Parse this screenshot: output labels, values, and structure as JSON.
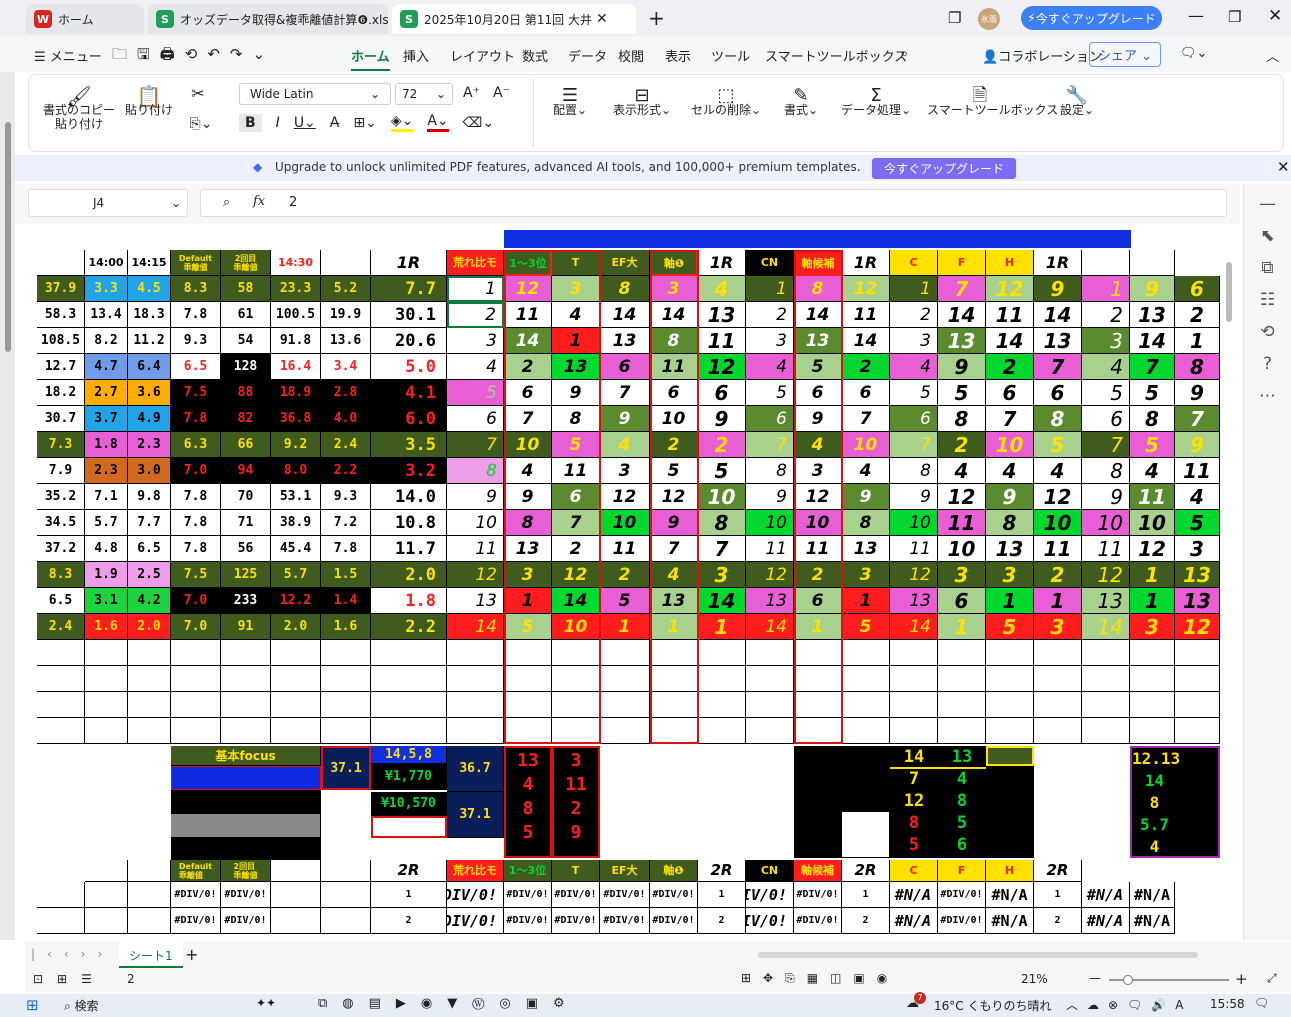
{
  "tabs": [
    {
      "icon": "W",
      "label": "ホーム",
      "color": "#d7261e"
    },
    {
      "icon": "S",
      "label": "オッズデータ取得&複乖離値計算❻.xlsx",
      "color": "#1e9e57"
    },
    {
      "icon": "S",
      "label": "2025年10月20日 第11回 大井",
      "color": "#1e9e57"
    }
  ],
  "upgrade_btn": "今すぐアップグレード",
  "avatar": "氷雨",
  "menu": {
    "main": "メニュー",
    "items": [
      "ホーム",
      "挿入",
      "レイアウト",
      "数式",
      "データ",
      "校閲",
      "表示",
      "ツール",
      "スマートツールボックス"
    ],
    "collab": "コラボレーション",
    "share": "シェア"
  },
  "ribbon": {
    "copy_fmt": "書式のコピー\n貼り付け",
    "paste": "貼り付け",
    "font": "Wide Latin",
    "size": "72",
    "align": "配置",
    "numfmt": "表示形式",
    "delcells": "セルの削除",
    "style": "書式",
    "dataproc": "データ処理",
    "smart": "スマートツールボックス",
    "settings": "設定"
  },
  "banner": {
    "text": "Upgrade to unlock unlimited PDF features, advanced AI tools, and 100,000+ premium templates.",
    "button": "今すぐアップグレード"
  },
  "formula": {
    "cell": "J4",
    "fx": "fx",
    "value": "2"
  },
  "header_row": [
    "",
    "14:00",
    "14:15",
    "Default\n乖離値",
    "2回目\n乖離値",
    "14:30",
    "",
    "1R",
    "荒れ比モ",
    "1〜3位",
    "T",
    "EF大",
    "軸❶",
    "1R",
    "CN",
    "軸候補",
    "1R",
    "C",
    "F",
    "H",
    "1R",
    "",
    ""
  ],
  "rows": [
    [
      "37.9",
      "3.3",
      "4.5",
      "8.3",
      "58",
      "23.3",
      "5.2",
      "7.7",
      "1",
      "12",
      "3",
      "8",
      "3",
      "4",
      "1",
      "8",
      "12",
      "1",
      "7",
      "12",
      "9",
      "1",
      "9",
      "6"
    ],
    [
      "58.3",
      "13.4",
      "18.3",
      "7.8",
      "61",
      "100.5",
      "19.9",
      "30.1",
      "2",
      "11",
      "4",
      "14",
      "14",
      "13",
      "2",
      "14",
      "11",
      "2",
      "14",
      "11",
      "14",
      "2",
      "13",
      "2"
    ],
    [
      "108.5",
      "8.2",
      "11.2",
      "9.3",
      "54",
      "91.8",
      "13.6",
      "20.6",
      "3",
      "14",
      "1",
      "13",
      "8",
      "11",
      "3",
      "13",
      "14",
      "3",
      "13",
      "14",
      "13",
      "3",
      "14",
      "1"
    ],
    [
      "12.7",
      "4.7",
      "6.4",
      "6.5",
      "128",
      "16.4",
      "3.4",
      "5.0",
      "4",
      "2",
      "13",
      "6",
      "11",
      "12",
      "4",
      "5",
      "2",
      "4",
      "9",
      "2",
      "7",
      "4",
      "7",
      "8"
    ],
    [
      "18.2",
      "2.7",
      "3.6",
      "7.5",
      "88",
      "18.9",
      "2.8",
      "4.1",
      "5",
      "6",
      "9",
      "7",
      "6",
      "6",
      "5",
      "6",
      "6",
      "5",
      "5",
      "6",
      "6",
      "5",
      "5",
      "9"
    ],
    [
      "30.7",
      "3.7",
      "4.9",
      "7.8",
      "82",
      "36.8",
      "4.0",
      "6.0",
      "6",
      "7",
      "8",
      "9",
      "10",
      "9",
      "6",
      "9",
      "7",
      "6",
      "8",
      "7",
      "8",
      "6",
      "8",
      "7"
    ],
    [
      "7.3",
      "1.8",
      "2.3",
      "6.3",
      "66",
      "9.2",
      "2.4",
      "3.5",
      "7",
      "10",
      "5",
      "4",
      "2",
      "2",
      "7",
      "4",
      "10",
      "7",
      "2",
      "10",
      "5",
      "7",
      "5",
      "9"
    ],
    [
      "7.9",
      "2.3",
      "3.0",
      "7.0",
      "94",
      "8.0",
      "2.2",
      "3.2",
      "8",
      "4",
      "11",
      "3",
      "5",
      "5",
      "8",
      "3",
      "4",
      "8",
      "4",
      "4",
      "4",
      "8",
      "4",
      "11"
    ],
    [
      "35.2",
      "7.1",
      "9.8",
      "7.8",
      "70",
      "53.1",
      "9.3",
      "14.0",
      "9",
      "9",
      "6",
      "12",
      "12",
      "10",
      "9",
      "12",
      "9",
      "9",
      "12",
      "9",
      "12",
      "9",
      "11",
      "4"
    ],
    [
      "34.5",
      "5.7",
      "7.7",
      "7.8",
      "71",
      "38.9",
      "7.2",
      "10.8",
      "10",
      "8",
      "7",
      "10",
      "9",
      "8",
      "10",
      "10",
      "8",
      "10",
      "11",
      "8",
      "10",
      "10",
      "10",
      "5"
    ],
    [
      "37.2",
      "4.8",
      "6.5",
      "7.8",
      "56",
      "45.4",
      "7.8",
      "11.7",
      "11",
      "13",
      "2",
      "11",
      "7",
      "7",
      "11",
      "11",
      "13",
      "11",
      "10",
      "13",
      "11",
      "11",
      "12",
      "3"
    ],
    [
      "8.3",
      "1.9",
      "2.5",
      "7.5",
      "125",
      "5.7",
      "1.5",
      "2.0",
      "12",
      "3",
      "12",
      "2",
      "4",
      "3",
      "12",
      "2",
      "3",
      "12",
      "3",
      "3",
      "2",
      "12",
      "1",
      "13"
    ],
    [
      "6.5",
      "3.1",
      "4.2",
      "7.0",
      "233",
      "12.2",
      "1.4",
      "1.8",
      "13",
      "1",
      "14",
      "5",
      "13",
      "14",
      "13",
      "6",
      "1",
      "13",
      "6",
      "1",
      "1",
      "13",
      "1",
      "13"
    ],
    [
      "2.4",
      "1.6",
      "2.0",
      "7.0",
      "91",
      "2.0",
      "1.6",
      "2.2",
      "14",
      "5",
      "10",
      "1",
      "1",
      "1",
      "14",
      "1",
      "5",
      "14",
      "1",
      "5",
      "3",
      "14",
      "3",
      "12"
    ]
  ],
  "focus": {
    "title": "基本focus",
    "v1": "37.1",
    "combo": "14,5,8",
    "pay1": "¥1,770",
    "v2": "36.7",
    "pay2": "¥10,570",
    "v3": "37.1"
  },
  "focus_cols": [
    [
      "13",
      "4",
      "8",
      "5"
    ],
    [
      "3",
      "11",
      "2",
      "9"
    ]
  ],
  "cfh_stack": [
    [
      "14",
      "7",
      "12",
      "8",
      "5"
    ],
    [
      "13",
      "4",
      "8",
      "5",
      "6"
    ]
  ],
  "right_stack": [
    "12.13",
    "14",
    "8",
    "5.7",
    "4"
  ],
  "header2": [
    "Default\n乖離値",
    "2回目\n乖離値",
    "",
    "",
    "2R",
    "荒れ比モ",
    "1〜3位",
    "T",
    "EF大",
    "軸❶",
    "2R",
    "CN",
    "軸候補",
    "2R",
    "C",
    "F",
    "H",
    "2R"
  ],
  "err_rows": [
    [
      "#DIV/0!",
      "#DIV/0!",
      "",
      "",
      "1",
      "#DIV/0!",
      "#DIV/0!",
      "#DIV/0!",
      "#DIV/0!",
      "#DIV/0!",
      "1",
      "#DIV/0!",
      "#DIV/0!",
      "1",
      "#N/A",
      "#DIV/0!",
      "#N/A",
      "1",
      "#N/A",
      "#N/A"
    ],
    [
      "#DIV/0!",
      "#DIV/0!",
      "",
      "",
      "2",
      "#DIV/0!",
      "#DIV/0!",
      "#DIV/0!",
      "#DIV/0!",
      "#DIV/0!",
      "2",
      "#DIV/0!",
      "#DIV/0!",
      "2",
      "#N/A",
      "#DIV/0!",
      "#N/A",
      "2",
      "#N/A",
      "#N/A"
    ]
  ],
  "sheet_tab": "シート1",
  "status": {
    "cell_value": "2",
    "zoom": "21%"
  },
  "taskbar": {
    "search": "検索",
    "weather": "16°C くもりのち晴れ",
    "time": "15:58",
    "badge": "7"
  }
}
